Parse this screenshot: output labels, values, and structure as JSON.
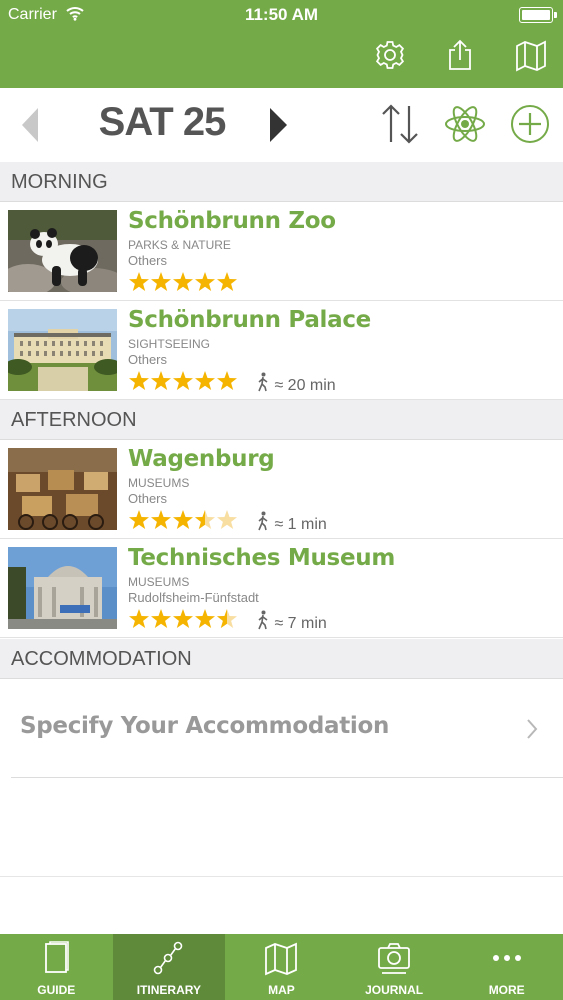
{
  "status_bar": {
    "carrier": "Carrier",
    "time": "11:50 AM"
  },
  "top_bar": {
    "icons": [
      "gear-icon",
      "share-icon",
      "map-icon"
    ]
  },
  "day_nav": {
    "title": "SAT 25",
    "actions": [
      "sort-icon",
      "atom-icon",
      "add-circle-icon"
    ]
  },
  "sections": {
    "morning": "MORNING",
    "afternoon": "AFTERNOON",
    "accommodation": "ACCOMMODATION"
  },
  "items": [
    {
      "title": "Schönbrunn Zoo",
      "category": "PARKS & NATURE",
      "location": "Others",
      "rating": 5,
      "walk": ""
    },
    {
      "title": "Schönbrunn Palace",
      "category": "SIGHTSEEING",
      "location": "Others",
      "rating": 5,
      "walk": "≈ 20 min"
    },
    {
      "title": "Wagenburg",
      "category": "MUSEUMS",
      "location": "Others",
      "rating": 3.5,
      "walk": "≈ 1 min"
    },
    {
      "title": "Technisches Museum",
      "category": "MUSEUMS",
      "location": "Rudolfsheim-Fünfstadt",
      "rating": 4.5,
      "walk": "≈ 7 min"
    }
  ],
  "accommodation": {
    "label": "Specify Your Accommodation"
  },
  "tabs": [
    {
      "label": "GUIDE",
      "icon": "guide-book-icon",
      "active": false
    },
    {
      "label": "ITINERARY",
      "icon": "itinerary-route-icon",
      "active": true
    },
    {
      "label": "MAP",
      "icon": "map-icon",
      "active": false
    },
    {
      "label": "JOURNAL",
      "icon": "journal-camera-icon",
      "active": false
    },
    {
      "label": "MORE",
      "icon": "more-dots-icon",
      "active": false
    }
  ],
  "colors": {
    "brand_green": "#75aa48",
    "active_tab": "#5e8a39",
    "star": "#f5b400",
    "section_bg": "#efeff1"
  }
}
